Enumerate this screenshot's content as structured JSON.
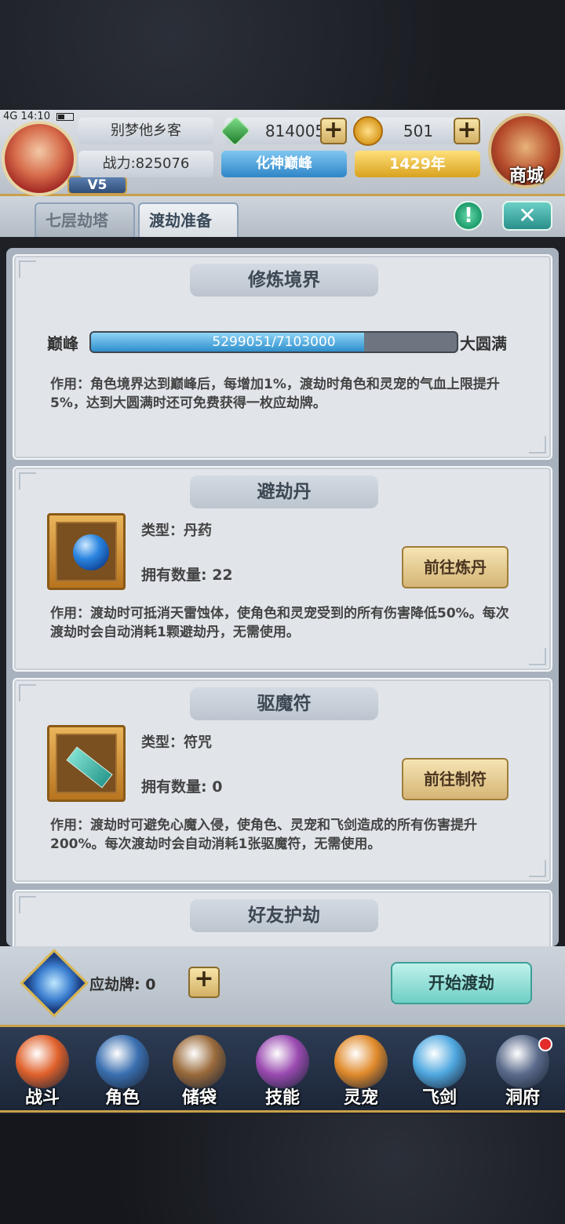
{
  "status": {
    "network": "4G",
    "time": "14:10"
  },
  "player": {
    "name": "别梦他乡客",
    "power": "战力:825076",
    "vip": "V5",
    "realm": "化神巅峰",
    "age": "1429年"
  },
  "resources": {
    "gems": "814005",
    "gold": "501",
    "plus": "+"
  },
  "shop": {
    "label": "商城"
  },
  "tabs": [
    {
      "label": "七层劫塔"
    },
    {
      "label": "渡劫准备"
    }
  ],
  "buttons": {
    "info": "!",
    "close": "✕"
  },
  "cultivation": {
    "title": "修炼境界",
    "level_left": "巅峰",
    "level_right": "大圆满",
    "progress_text": "5299051/7103000",
    "progress_fraction": 0.746,
    "desc": "作用：角色境界达到巅峰后，每增加1%，渡劫时角色和灵宠的气血上限提升5%，达到大圆满时还可免费获得一枚应劫牌。"
  },
  "items": [
    {
      "title": "避劫丹",
      "type": "类型：丹药",
      "count": "拥有数量: 22",
      "button": "前往炼丹",
      "desc": "作用：渡劫时可抵消天雷蚀体，使角色和灵宠受到的所有伤害降低50%。每次渡劫时会自动消耗1颗避劫丹，无需使用。"
    },
    {
      "title": "驱魔符",
      "type": "类型：符咒",
      "count": "拥有数量: 0",
      "button": "前往制符",
      "desc": "作用：渡劫时可避免心魔入侵，使角色、灵宠和飞剑造成的所有伤害提升200%。每次渡劫时会自动消耗1张驱魔符，无需使用。"
    }
  ],
  "friend_section": {
    "title": "好友护劫"
  },
  "action": {
    "token_label": "应劫牌: 0",
    "start_button": "开始渡劫"
  },
  "nav": [
    {
      "label": "战斗",
      "color": "#e0612b"
    },
    {
      "label": "角色",
      "color": "#3a6fb0"
    },
    {
      "label": "储袋",
      "color": "#9a6a3a"
    },
    {
      "label": "技能",
      "color": "#9a4ab0"
    },
    {
      "label": "灵宠",
      "color": "#e08a2b"
    },
    {
      "label": "飞剑",
      "color": "#4fa8e0"
    },
    {
      "label": "洞府",
      "color": "#5a6a8a"
    }
  ]
}
